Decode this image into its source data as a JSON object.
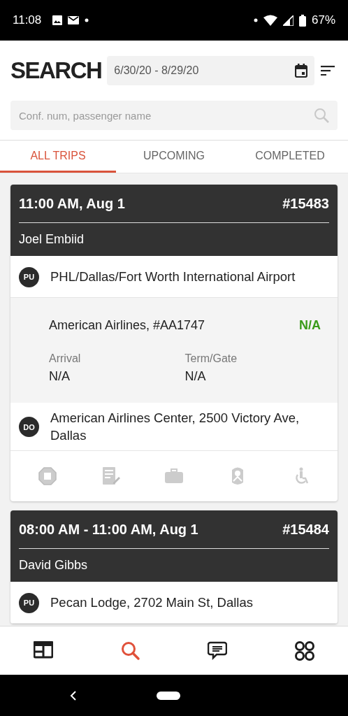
{
  "status_bar": {
    "time": "11:08",
    "battery": "67%"
  },
  "header": {
    "title": "SEARCH",
    "date_range": "6/30/20 - 8/29/20",
    "search": {
      "placeholder": "Conf. num, passenger name"
    }
  },
  "tabs": [
    {
      "label": "ALL TRIPS",
      "selected": true
    },
    {
      "label": "UPCOMING",
      "selected": false
    },
    {
      "label": "COMPLETED",
      "selected": false
    }
  ],
  "trips": [
    {
      "time": "11:00 AM, Aug 1",
      "number": "#15483",
      "passenger": "Joel Embiid",
      "amenities_shown": true,
      "stops": [
        {
          "kind": "stop",
          "badge": "PU",
          "address": "PHL/Dallas/Fort Worth International Airport"
        },
        {
          "kind": "flight",
          "flight": "American Airlines, #AA1747",
          "status": "N/A",
          "fields": [
            {
              "label": "Arrival",
              "value": "N/A"
            },
            {
              "label": "Term/Gate",
              "value": "N/A"
            }
          ]
        },
        {
          "kind": "stop",
          "badge": "DO",
          "address": "American Airlines Center, 2500 Victory Ave, Dallas"
        }
      ]
    },
    {
      "time": "08:00 AM - 11:00 AM, Aug 1",
      "number": "#15484",
      "passenger": "David Gibbs",
      "amenities_shown": false,
      "stops": [
        {
          "kind": "stop",
          "badge": "PU",
          "address": "Pecan Lodge, 2702 Main St, Dallas"
        }
      ]
    }
  ],
  "bottom_nav": [
    {
      "kind": "dashboard",
      "selected": false
    },
    {
      "kind": "search",
      "selected": true
    },
    {
      "kind": "messages",
      "selected": false
    },
    {
      "kind": "more",
      "selected": false
    }
  ]
}
